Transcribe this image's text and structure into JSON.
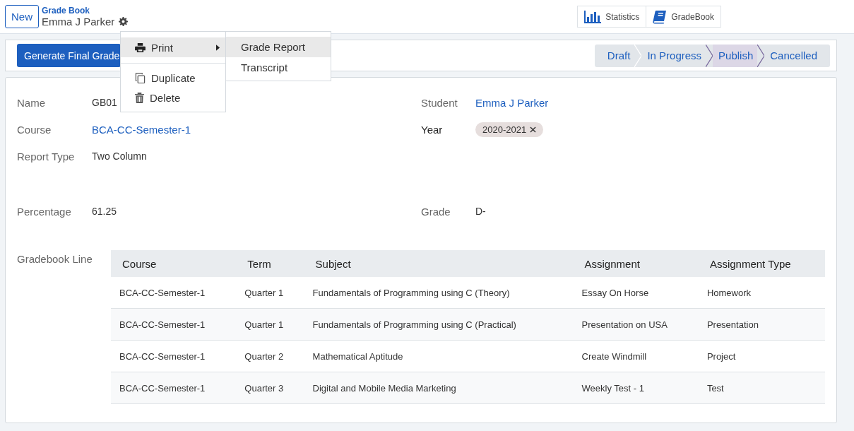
{
  "control_panel": {
    "new_button": "New",
    "breadcrumb": "Grade Book",
    "record_title": "Emma J Parker",
    "smart_buttons": [
      {
        "label": "Statistics"
      },
      {
        "label": "GradeBook"
      }
    ]
  },
  "action_menu": {
    "items": [
      {
        "label": "Print",
        "selected": true,
        "has_submenu": true
      },
      {
        "label": "Duplicate",
        "selected": false,
        "has_submenu": false
      },
      {
        "label": "Delete",
        "selected": false,
        "has_submenu": false
      }
    ],
    "submenu": [
      {
        "label": "Grade Report",
        "selected": true
      },
      {
        "label": "Transcript",
        "selected": false
      }
    ]
  },
  "header": {
    "button": "Generate Final Grade",
    "stages": [
      {
        "label": "Draft",
        "selected": false
      },
      {
        "label": "In Progress",
        "selected": false
      },
      {
        "label": "Publish",
        "selected": true
      },
      {
        "label": "Cancelled",
        "selected": false
      }
    ]
  },
  "form": {
    "left": [
      {
        "label": "Name",
        "value": "GB01",
        "kind": "text"
      },
      {
        "label": "Course",
        "value": "BCA-CC-Semester-1",
        "kind": "link"
      },
      {
        "label": "Report Type",
        "value": "Two Column",
        "kind": "text"
      },
      {
        "label": "Percentage",
        "value": "61.25",
        "kind": "text"
      }
    ],
    "right": [
      {
        "label": "Student",
        "value": "Emma J Parker",
        "kind": "link",
        "required": false
      },
      {
        "label": "Year",
        "value": "2020-2021",
        "kind": "tag",
        "required": true
      },
      {
        "label": "Grade",
        "value": "D-",
        "kind": "text",
        "required": false
      }
    ],
    "line_label": "Gradebook Line",
    "table": {
      "columns": [
        "Course",
        "Term",
        "Subject",
        "Assignment",
        "Assignment Type"
      ],
      "rows": [
        [
          "BCA-CC-Semester-1",
          "Quarter 1",
          "Fundamentals of Programming using C (Theory)",
          "Essay On Horse",
          "Homework"
        ],
        [
          "BCA-CC-Semester-1",
          "Quarter 1",
          "Fundamentals of Programming using C (Practical)",
          "Presentation on USA",
          "Presentation"
        ],
        [
          "BCA-CC-Semester-1",
          "Quarter 2",
          "Mathematical Aptitude",
          "Create Windmill",
          "Project"
        ],
        [
          "BCA-CC-Semester-1",
          "Quarter 3",
          "Digital and Mobile Media Marketing",
          "Weekly Test - 1",
          "Test"
        ]
      ]
    }
  }
}
